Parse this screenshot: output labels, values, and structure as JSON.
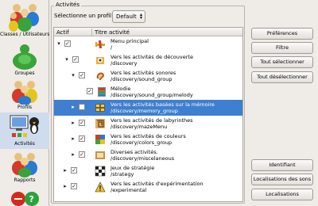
{
  "sidebar": {
    "items": [
      {
        "label": "Classes / Utilisateurs",
        "icon": "users-group-icon"
      },
      {
        "label": "Groupes",
        "icon": "groups-icon"
      },
      {
        "label": "Profils",
        "icon": "profiles-icon"
      },
      {
        "label": "Activités",
        "icon": "activities-icon",
        "selected": true
      },
      {
        "label": "Rapports",
        "icon": "reports-icon"
      }
    ]
  },
  "main": {
    "group_title": "Activités",
    "profile_label": "Sélectionne un profil :",
    "profile_value": "Default",
    "tree": {
      "col_actif": "Actif",
      "col_titre": "Titre activité",
      "rows": [
        {
          "title": "Menu principal",
          "path": "/",
          "expander": "▾",
          "checked": true
        },
        {
          "title": "Vers les activités de découverte",
          "path": "/discovery",
          "expander": "▾",
          "checked": true
        },
        {
          "title": "Vers les activités sonores",
          "path": "/discovery/sound_group",
          "expander": "▾",
          "checked": true
        },
        {
          "title": "Mélodie",
          "path": "/discovery/sound_group/melody",
          "expander": "",
          "checked": true
        },
        {
          "title": "Vers les activités basées sur la mémoire",
          "path": "/discovery/memory_group",
          "expander": "▸",
          "checked": false
        },
        {
          "title": "Vers les activités de labyrinthes",
          "path": "/discovery/mazeMenu",
          "expander": "▸",
          "checked": true
        },
        {
          "title": "Vers les activités de couleurs",
          "path": "/discovery/colors_group",
          "expander": "▸",
          "checked": true
        },
        {
          "title": "Diverses activités.",
          "path": "/discovery/miscelaneous",
          "expander": "▸",
          "checked": true
        },
        {
          "title": "Jeux de stratégie",
          "path": "/strategy",
          "expander": "▸",
          "checked": true
        },
        {
          "title": "Vers les activités d'expérimentation",
          "path": "/experimental",
          "expander": "▸",
          "checked": true
        }
      ]
    }
  },
  "buttons": {
    "preferences": "Préférences",
    "filtre": "Filtre",
    "tout_selectionner": "Tout sélectionner",
    "tout_deselectionner": "Tout désélectionner",
    "identifiant": "Identifiant",
    "localisations_sons": "Localisations des sons",
    "localisations": "Localisations"
  }
}
